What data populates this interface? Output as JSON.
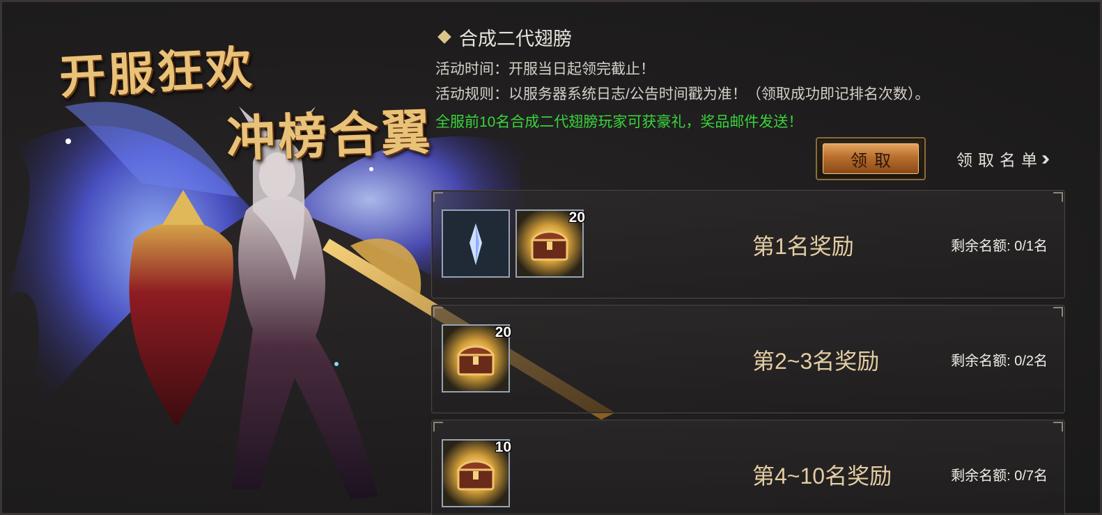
{
  "banner": {
    "title_line1": "开服狂欢",
    "title_line2": "冲榜合翼"
  },
  "activity": {
    "heading": "合成二代翅膀",
    "time_label": "活动时间：",
    "time_value": "开服当日起领完截止！",
    "rule_label": "活动规则：",
    "rule_value": "以服务器系统日志/公告时间戳为准！（领取成功即记排名次数）。",
    "highlight": "全服前10名合成二代翅膀玩家可获豪礼，奖品邮件发送！"
  },
  "actions": {
    "claim_label": "领取",
    "list_label": "领取名单",
    "list_icon": "double-chevron-right-icon"
  },
  "rewards": [
    {
      "rank_label": "第1名奖励",
      "quota_label": "剩余名额: 0/1名",
      "items": [
        {
          "icon": "crystal-shard-icon",
          "count": ""
        },
        {
          "icon": "treasure-chest-icon",
          "count": "20"
        }
      ]
    },
    {
      "rank_label": "第2~3名奖励",
      "quota_label": "剩余名额: 0/2名",
      "items": [
        {
          "icon": "treasure-chest-icon",
          "count": "20"
        }
      ]
    },
    {
      "rank_label": "第4~10名奖励",
      "quota_label": "剩余名额: 0/7名",
      "items": [
        {
          "icon": "treasure-chest-icon",
          "count": "10"
        }
      ]
    }
  ],
  "colors": {
    "accent_gold": "#e4cda3",
    "highlight_green": "#37d53a",
    "button_orange": "#b86e2d"
  }
}
